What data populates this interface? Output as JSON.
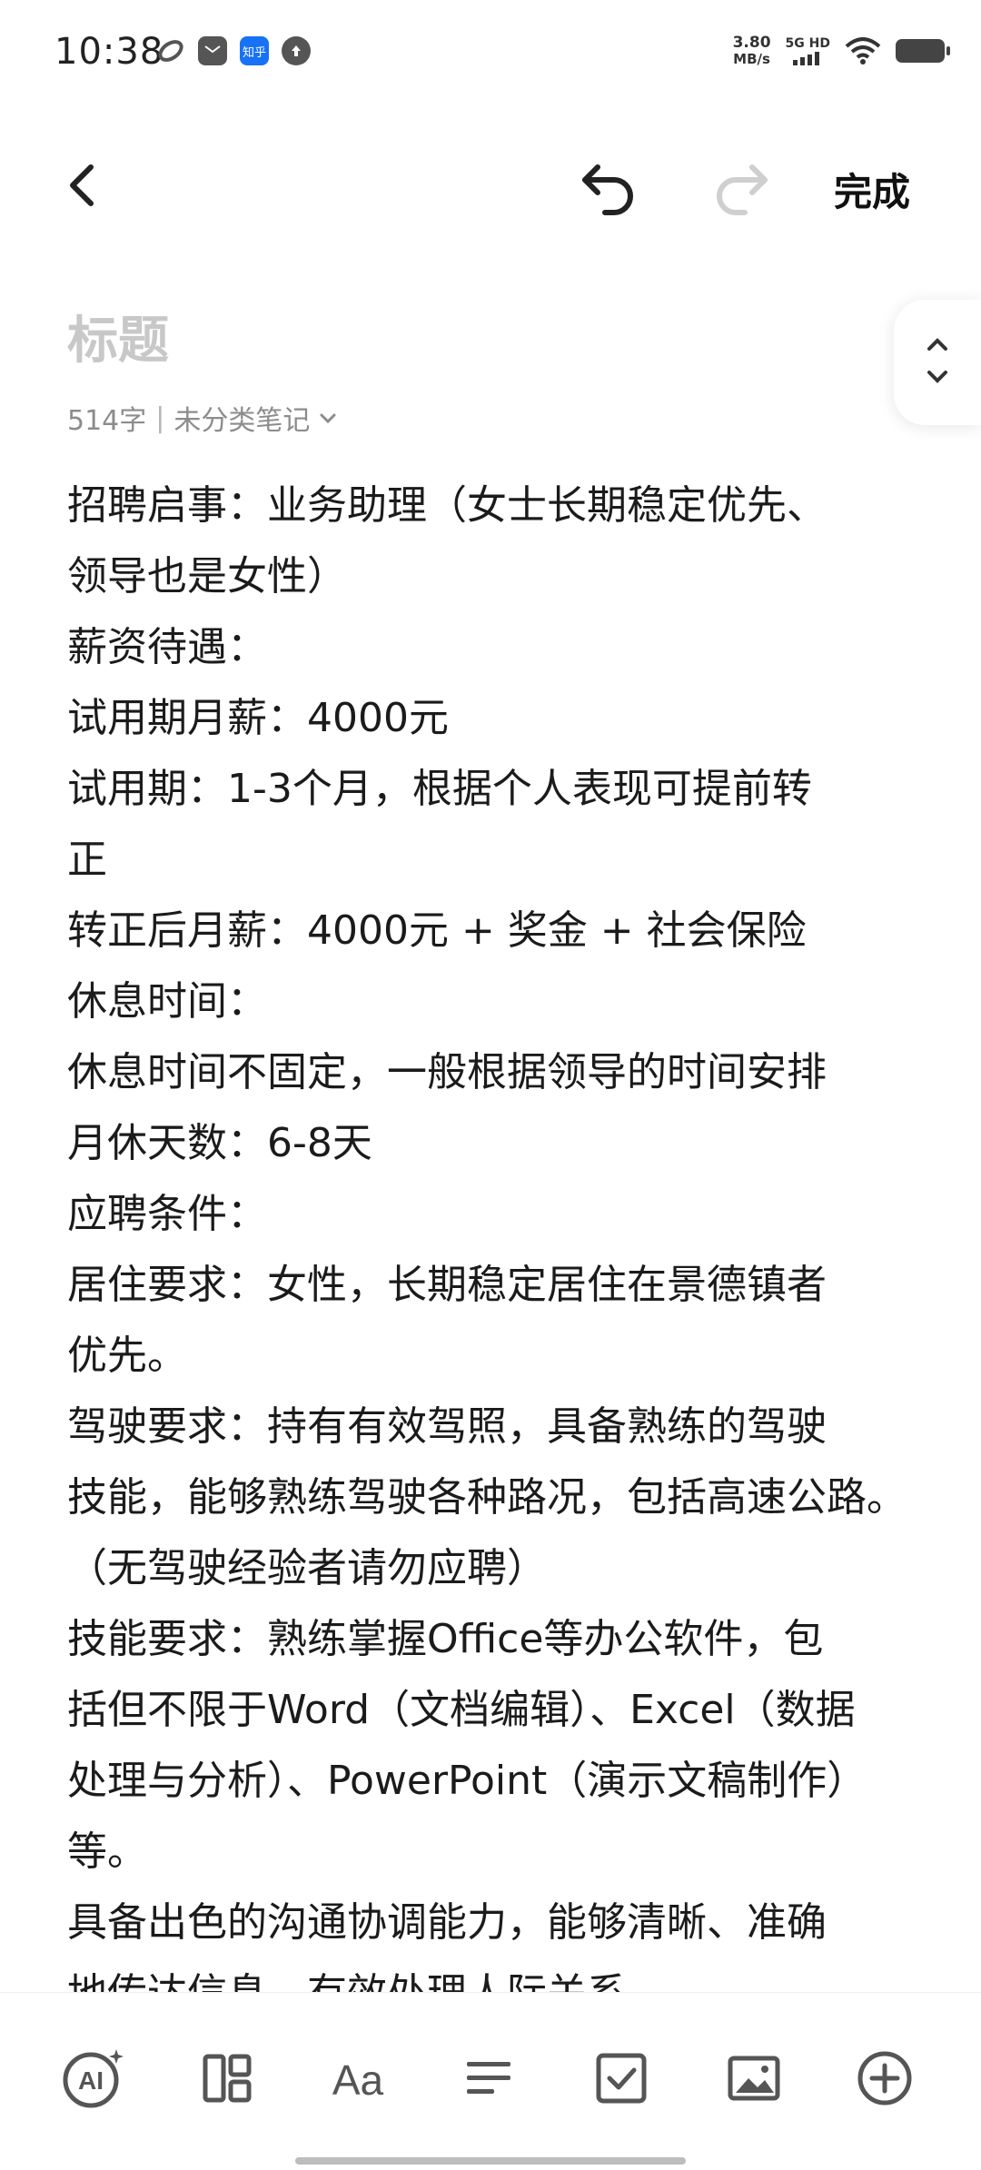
{
  "status_bar": {
    "time": "10:38",
    "network_speed_value": "3.80",
    "network_speed_unit": "MB/s",
    "network_type": "5G HD",
    "icons": [
      "app-swirl-icon",
      "message-icon",
      "zhihu-icon",
      "upload-icon",
      "signal-icon",
      "wifi-icon",
      "battery-icon"
    ],
    "zhihu_label": "知乎"
  },
  "toolbar": {
    "done_label": "完成"
  },
  "note": {
    "title_placeholder": "标题",
    "char_count": "514字",
    "separator": "|",
    "category": "未分类笔记",
    "lines": [
      "招聘启事：业务助理（女士长期稳定优先、",
      "领导也是女性）",
      "薪资待遇：",
      "试用期月薪：4000元",
      "试用期：1-3个月，根据个人表现可提前转",
      "正",
      "转正后月薪：4000元 + 奖金 + 社会保险",
      "休息时间：",
      "休息时间不固定，一般根据领导的时间安排",
      "月休天数：6-8天",
      "应聘条件：",
      "居住要求：女性，长期稳定居住在景德镇者",
      "优先。",
      "驾驶要求：持有有效驾照，具备熟练的驾驶",
      "技能，能够熟练驾驶各种路况，包括高速公路。",
      "（无驾驶经验者请勿应聘）",
      "技能要求：熟练掌握Office等办公软件，包",
      "括但不限于Word（文档编辑）、Excel（数据",
      "处理与分析）、PowerPoint（演示文稿制作）",
      "等。",
      "具备出色的沟通协调能力，能够清晰、准确",
      "地传达信息，有效处理人际关系。"
    ]
  },
  "bottom_toolbar": {
    "items": [
      "ai-assistant-icon",
      "layout-template-icon",
      "text-format-icon",
      "paragraph-align-icon",
      "checkbox-icon",
      "image-icon",
      "add-circle-icon"
    ]
  }
}
